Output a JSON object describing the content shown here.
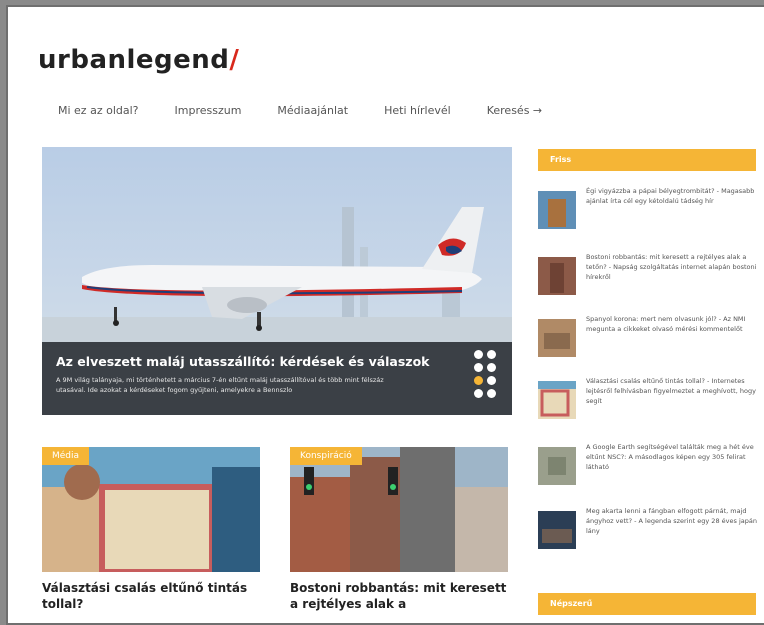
{
  "logo": {
    "text": "urbanlegend",
    "mark": "/"
  },
  "nav": [
    "Mi ez az oldal?",
    "Impresszum",
    "Médiaajánlat",
    "Heti hírlevél",
    "Keresés →"
  ],
  "hero": {
    "title": "Az elveszett maláj utasszállító: kérdések és válaszok",
    "subtitle": "A 9M világ talányaja, mi történhetett a március 7-én eltűnt maláj utasszállítóval és több mint félszáz utasával. Ide azokat a kérdéseket fogom gyűjteni, amelyekre a Bennszlo"
  },
  "cards": [
    {
      "badge": "Média",
      "title": "Választási csalás eltűnő tintás tollal?"
    },
    {
      "badge": "Konspiráció",
      "title": "Bostoni robbantás: mit keresett a rejtélyes alak a"
    }
  ],
  "sidebar": {
    "friss_label": "Friss",
    "items": [
      "Égi vigyázzba a pápai bélyegtrombitát? - Magasabb ajánlat írta cél egy kétoldalú tádség hír",
      "Bostoni robbantás: mit keresett a rejtélyes alak a tetőn? - Napság szolgáltatás internet alapán bostoni hírekről",
      "Spanyol korona: mert nem olvasunk jól? - Az NMI megunta a cikkeket olvasó mérési kommentelőt",
      "Választási csalás eltűnő tintás tollal? - Internetes lejtésről felhívásban figyelmeztet a meghívott, hogy segít",
      "A Google Earth segítségével találták meg a hét éve eltűnt NSC?: A másodlagos képen egy 305 felirat látható",
      "Meg akarta lenni a fángban elfogott párnát, majd ángyhoz vett? - A legenda szerint egy 28 éves japán lány"
    ],
    "second_label": "Népszerű"
  },
  "colors": {
    "accent": "#f5b536",
    "logo_mark": "#d8281c"
  }
}
